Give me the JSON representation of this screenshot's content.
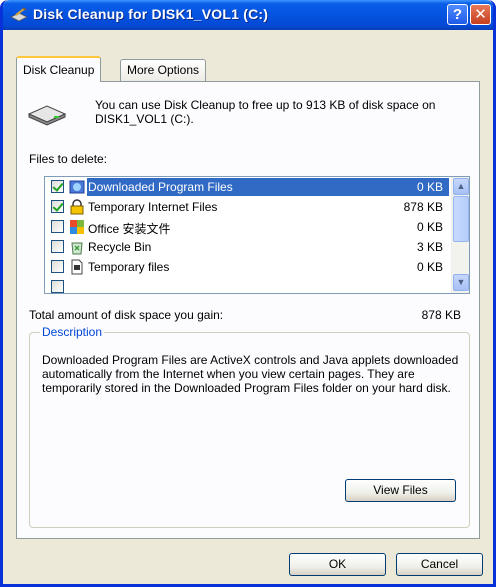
{
  "window": {
    "title": "Disk Cleanup for DISK1_VOL1 (C:)",
    "help_label": "?",
    "close_label": "✕"
  },
  "tabs": [
    {
      "label": "Disk Cleanup",
      "active": true
    },
    {
      "label": "More Options",
      "active": false
    }
  ],
  "intro_text": "You can use Disk Cleanup to free up to 913 KB of disk space on DISK1_VOL1 (C:).",
  "files_label": "Files to delete:",
  "files": [
    {
      "name": "Downloaded Program Files",
      "size": "0 KB",
      "checked": true,
      "selected": true,
      "icon": "downloaded-files-icon"
    },
    {
      "name": "Temporary Internet Files",
      "size": "878 KB",
      "checked": true,
      "selected": false,
      "icon": "lock-icon"
    },
    {
      "name": "Office 安装文件",
      "size": "0 KB",
      "checked": false,
      "selected": false,
      "icon": "office-icon"
    },
    {
      "name": "Recycle Bin",
      "size": "3 KB",
      "checked": false,
      "selected": false,
      "icon": "recycle-bin-icon"
    },
    {
      "name": "Temporary files",
      "size": "0 KB",
      "checked": false,
      "selected": false,
      "icon": "temp-file-icon"
    }
  ],
  "total_label": "Total amount of disk space you gain:",
  "total_value": "878 KB",
  "description": {
    "legend": "Description",
    "text": "Downloaded Program Files are ActiveX controls and Java applets downloaded automatically from the Internet when you view certain pages. They are temporarily stored in the Downloaded Program Files folder on your hard disk."
  },
  "buttons": {
    "view_files": "View Files",
    "ok": "OK",
    "cancel": "Cancel"
  },
  "colors": {
    "titlebar": "#0553e1",
    "selection": "#316ac5",
    "legend": "#0046d5"
  }
}
